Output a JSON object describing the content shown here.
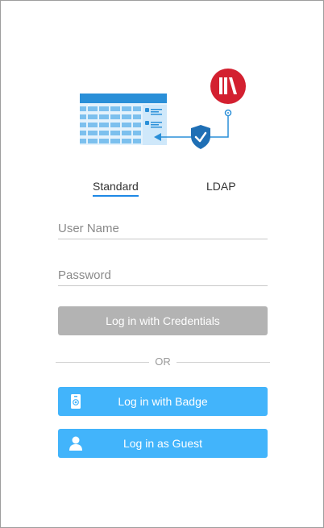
{
  "tabs": {
    "standard": "Standard",
    "ldap": "LDAP"
  },
  "form": {
    "username_placeholder": "User Name",
    "password_placeholder": "Password",
    "credentials_button": "Log in with Credentials"
  },
  "divider": "OR",
  "badge_button": "Log in with Badge",
  "guest_button": "Log in as Guest",
  "colors": {
    "accent": "#1e88e5",
    "primary_button": "#42b4fb",
    "disabled_button": "#b3b3b3",
    "brand_red": "#d32030"
  },
  "icons": {
    "hero": "datagrid-ldap-illustration",
    "shield": "shield-check-icon",
    "brand": "brand-logo",
    "badge": "badge-icon",
    "guest": "person-icon"
  }
}
